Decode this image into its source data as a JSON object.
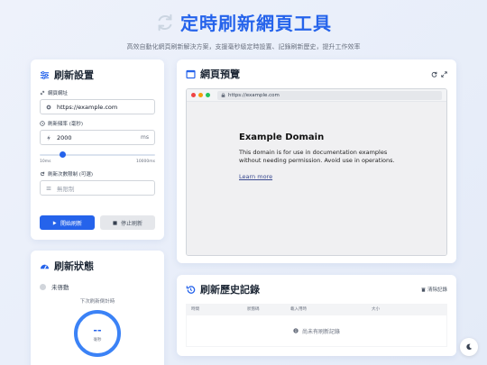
{
  "header": {
    "title": "定時刷新網頁工具",
    "subtitle": "高效自動化網頁刷新解決方案，支援毫秒級定時設置、記錄刷新歷史，提升工作效率"
  },
  "settings": {
    "title": "刷新設置",
    "url_label": "網頁網址",
    "url_value": "https://example.com",
    "interval_label": "刷新頻率 (毫秒)",
    "interval_value": "2000",
    "interval_unit": "ms",
    "slider_min_label": "10ms",
    "slider_max_label": "10000ms",
    "slider_fraction": 0.2,
    "count_label": "刷新次數限制 (可選)",
    "count_placeholder": "無限制",
    "start_label": "開始刷新",
    "stop_label": "停止刷新"
  },
  "status": {
    "title": "刷新狀態",
    "state": "未啓動",
    "countdown_label": "下次刷新倒計時",
    "countdown_value": "--",
    "countdown_unit": "毫秒"
  },
  "preview": {
    "title": "網頁預覽",
    "address": "https://example.com",
    "page_title": "Example Domain",
    "page_text": "This domain is for use in documentation examples without needing permission. Avoid use in operations.",
    "page_link": "Learn more"
  },
  "history": {
    "title": "刷新歷史記錄",
    "clear_label": "清除記錄",
    "columns": [
      "時間",
      "狀態碼",
      "載入用時",
      "大小"
    ],
    "empty_text": "尚未有刷新記錄"
  },
  "colors": {
    "accent": "#2563eb",
    "dot_red": "#ef4444",
    "dot_yellow": "#f59e0b",
    "dot_green": "#22c55e"
  }
}
